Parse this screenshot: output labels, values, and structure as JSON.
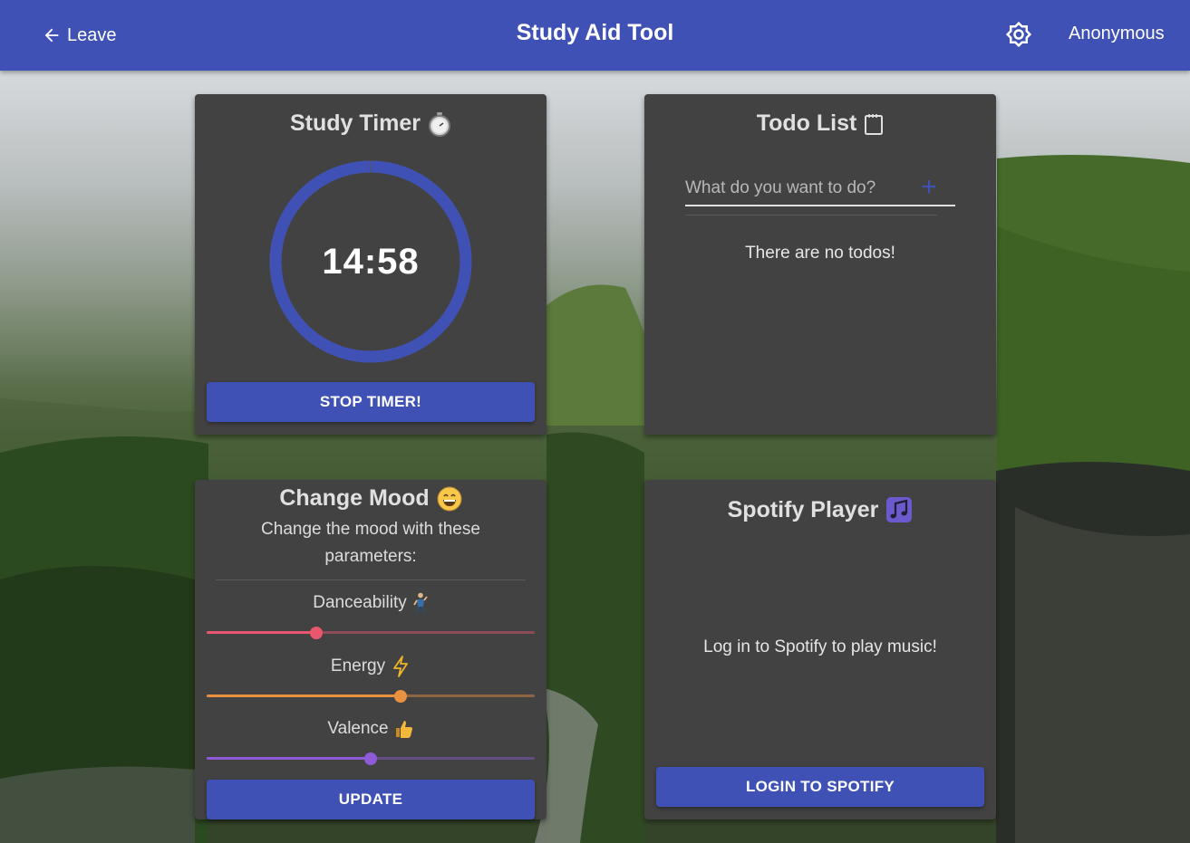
{
  "header": {
    "leave_label": "Leave",
    "title": "Study Aid Tool",
    "user": "Anonymous",
    "color": "#3f51b5"
  },
  "timer": {
    "title": "Study Timer",
    "title_icon": "stopwatch-icon",
    "time": "14:58",
    "progress": 0.998,
    "button_label": "STOP TIMER!"
  },
  "todo": {
    "title": "Todo List",
    "title_icon": "notepad-icon",
    "input_value": "",
    "input_placeholder": "What do you want to do?",
    "add_icon": "plus-icon",
    "empty_message": "There are no todos!"
  },
  "mood": {
    "title": "Change Mood",
    "title_icon": "grinning-face-icon",
    "description": "Change the mood with these parameters:",
    "params": [
      {
        "label": "Danceability",
        "icon": "dancer-icon",
        "value": 0.335,
        "color": "#e8576e"
      },
      {
        "label": "Energy",
        "icon": "lightning-icon",
        "value": 0.59,
        "color": "#e8913f"
      },
      {
        "label": "Valence",
        "icon": "thumbs-up-icon",
        "value": 0.5,
        "color": "#8e5ad8"
      }
    ],
    "button_label": "UPDATE"
  },
  "spotify": {
    "title": "Spotify Player",
    "title_icon": "music-notes-icon",
    "message": "Log in to Spotify to play music!",
    "button_label": "LOGIN TO SPOTIFY"
  }
}
